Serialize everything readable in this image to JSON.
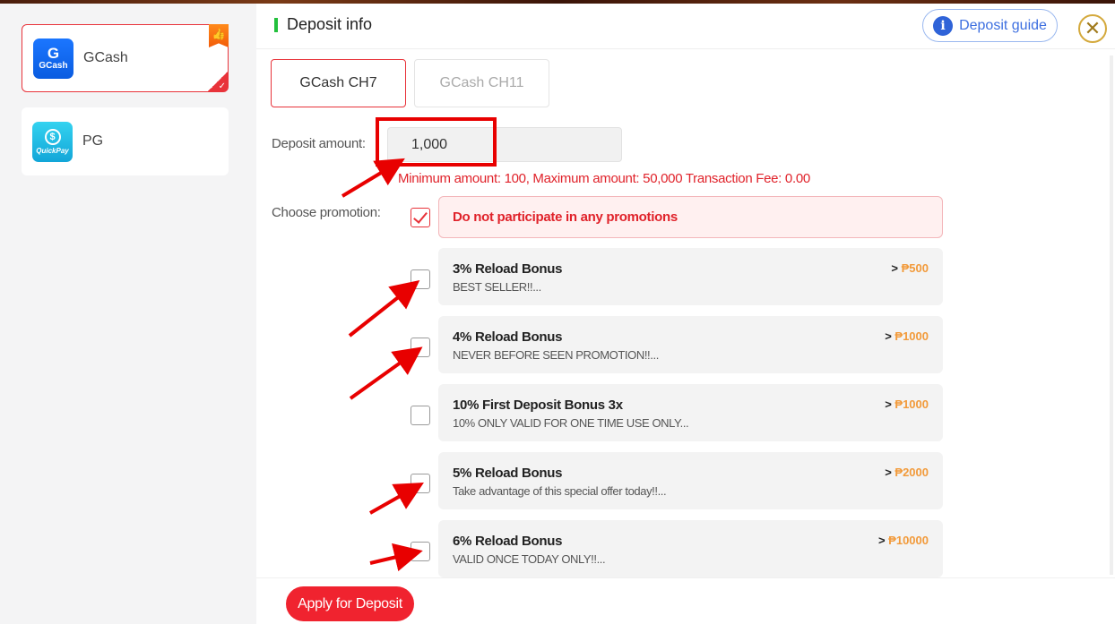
{
  "sidebar": {
    "methods": [
      {
        "name": "GCash",
        "logo_top": "G",
        "logo_bottom": "GCash",
        "active": true,
        "badge": "thumbs-up-icon"
      },
      {
        "name": "PG",
        "logo_top": "$",
        "logo_bottom": "QuickPay",
        "active": false
      }
    ]
  },
  "header": {
    "title": "Deposit info",
    "guide_label": "Deposit guide",
    "guide_icon": "info-icon",
    "close_icon": "close-icon"
  },
  "channels": [
    {
      "label": "GCash CH7",
      "active": true
    },
    {
      "label": "GCash CH11",
      "active": false
    }
  ],
  "form": {
    "amount_label": "Deposit amount:",
    "amount_value": "1,000",
    "limits_text": "Minimum amount:  100,  Maximum amount:  50,000   Transaction Fee:  0.00",
    "promotion_label": "Choose promotion:"
  },
  "promotions": {
    "none_label": "Do not participate in any promotions",
    "none_checked": true,
    "items": [
      {
        "title": "3% Reload Bonus",
        "desc": "BEST SELLER!!...",
        "min_prefix": ">",
        "min_amount": "₱500"
      },
      {
        "title": "4% Reload Bonus",
        "desc": "NEVER BEFORE SEEN PROMOTION!!...",
        "min_prefix": ">",
        "min_amount": "₱1000"
      },
      {
        "title": "10% First Deposit Bonus 3x",
        "desc": "10% ONLY VALID FOR ONE TIME USE ONLY...",
        "min_prefix": ">",
        "min_amount": "₱1000"
      },
      {
        "title": "5% Reload Bonus",
        "desc": "Take advantage of this special offer today!!...",
        "min_prefix": ">",
        "min_amount": "₱2000"
      },
      {
        "title": "6% Reload Bonus",
        "desc": "VALID ONCE TODAY ONLY!!...",
        "min_prefix": ">",
        "min_amount": "₱10000"
      }
    ]
  },
  "apply_label": "Apply for Deposit",
  "colors": {
    "accent": "#e8333a",
    "amount": "#f29a3a",
    "guide": "#3d6fe0",
    "marker": "#e80000"
  }
}
